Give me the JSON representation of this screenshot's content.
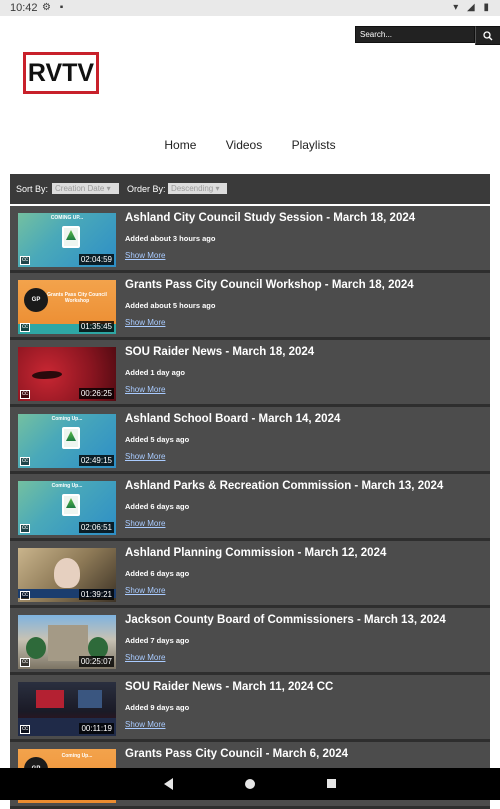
{
  "status_bar": {
    "time": "10:42",
    "notif_icons": "⚙ ▪",
    "sys_icons": "▾ ◢ ▮"
  },
  "header": {
    "search_placeholder": "Search...",
    "search_icon": "magnifier",
    "logo_text": "RVTV"
  },
  "nav": {
    "items": [
      "Home",
      "Videos",
      "Playlists"
    ]
  },
  "sort_bar": {
    "sort_by_label": "Sort By:",
    "sort_by_value": "Creation Date",
    "order_by_label": "Order By:",
    "order_by_value": "Descending"
  },
  "videos": [
    {
      "title": "Ashland City Council Study Session - March 18, 2024",
      "added": "Added about 3 hours ago",
      "more": "Show More",
      "duration": "02:04:59",
      "thumb_text": "COMING UP..."
    },
    {
      "title": "Grants Pass City Council Workshop - March 18, 2024",
      "added": "Added about 5 hours ago",
      "more": "Show More",
      "duration": "01:35:45",
      "thumb_text": "Grants Pass City Council Workshop"
    },
    {
      "title": "SOU Raider News - March 18, 2024",
      "added": "Added 1 day ago",
      "more": "Show More",
      "duration": "00:26:25",
      "thumb_text": ""
    },
    {
      "title": "Ashland School Board - March 14, 2024",
      "added": "Added 5 days ago",
      "more": "Show More",
      "duration": "02:49:15",
      "thumb_text": "Coming Up..."
    },
    {
      "title": "Ashland Parks & Recreation Commission - March 13, 2024",
      "added": "Added 6 days ago",
      "more": "Show More",
      "duration": "02:06:51",
      "thumb_text": "Coming Up..."
    },
    {
      "title": "Ashland Planning Commission - March 12, 2024",
      "added": "Added 6 days ago",
      "more": "Show More",
      "duration": "01:39:21",
      "thumb_text": ""
    },
    {
      "title": "Jackson County Board of Commissioners - March 13, 2024",
      "added": "Added 7 days ago",
      "more": "Show More",
      "duration": "00:25:07",
      "thumb_text": ""
    },
    {
      "title": "SOU Raider News - March 11, 2024 CC",
      "added": "Added 9 days ago",
      "more": "Show More",
      "duration": "00:11:19",
      "thumb_text": ""
    },
    {
      "title": "Grants Pass City Council - March 6, 2024",
      "added": "",
      "more": "",
      "duration": "",
      "thumb_text": "Coming Up..."
    }
  ],
  "colors": {
    "logo_border": "#c8202a",
    "list_bg": "#4c4c4c",
    "link": "#a9cbff"
  }
}
